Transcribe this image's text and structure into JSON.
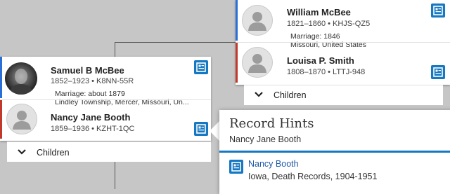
{
  "parents": {
    "father": {
      "name": "William McBee",
      "vitals": "1821–1860 • KHJS-QZ5",
      "has_hint": true
    },
    "marriage": {
      "line1": "Marriage: 1846",
      "line2": "Missouri, United States"
    },
    "mother": {
      "name": "Louisa P. Smith",
      "vitals": "1808–1870 • LTTJ-948",
      "has_hint": true
    },
    "children_label": "Children"
  },
  "couple": {
    "husband": {
      "name": "Samuel B McBee",
      "vitals": "1852–1923 • K8NN-55R",
      "has_hint": true
    },
    "marriage": {
      "line1": "Marriage: about 1879",
      "line2": "Lindley Township, Mercer, Missouri, Un..."
    },
    "wife": {
      "name": "Nancy Jane Booth",
      "vitals": "1859–1936 • KZHT-1QC",
      "has_hint": true
    },
    "children_label": "Children"
  },
  "record_hints": {
    "title": "Record Hints",
    "person": "Nancy Jane Booth",
    "hints": [
      {
        "name": "Nancy Booth",
        "description": "Iowa, Death Records, 1904-1951"
      }
    ]
  },
  "colors": {
    "background": "#c6c6c6",
    "male": "#2a6fd6",
    "female": "#c0392b",
    "hint_blue": "#1678c2",
    "link_blue": "#1f58a6"
  },
  "icons": {
    "avatar": "person-silhouette-icon",
    "hint": "record-hint-icon",
    "expand": "chevron-down-icon"
  }
}
